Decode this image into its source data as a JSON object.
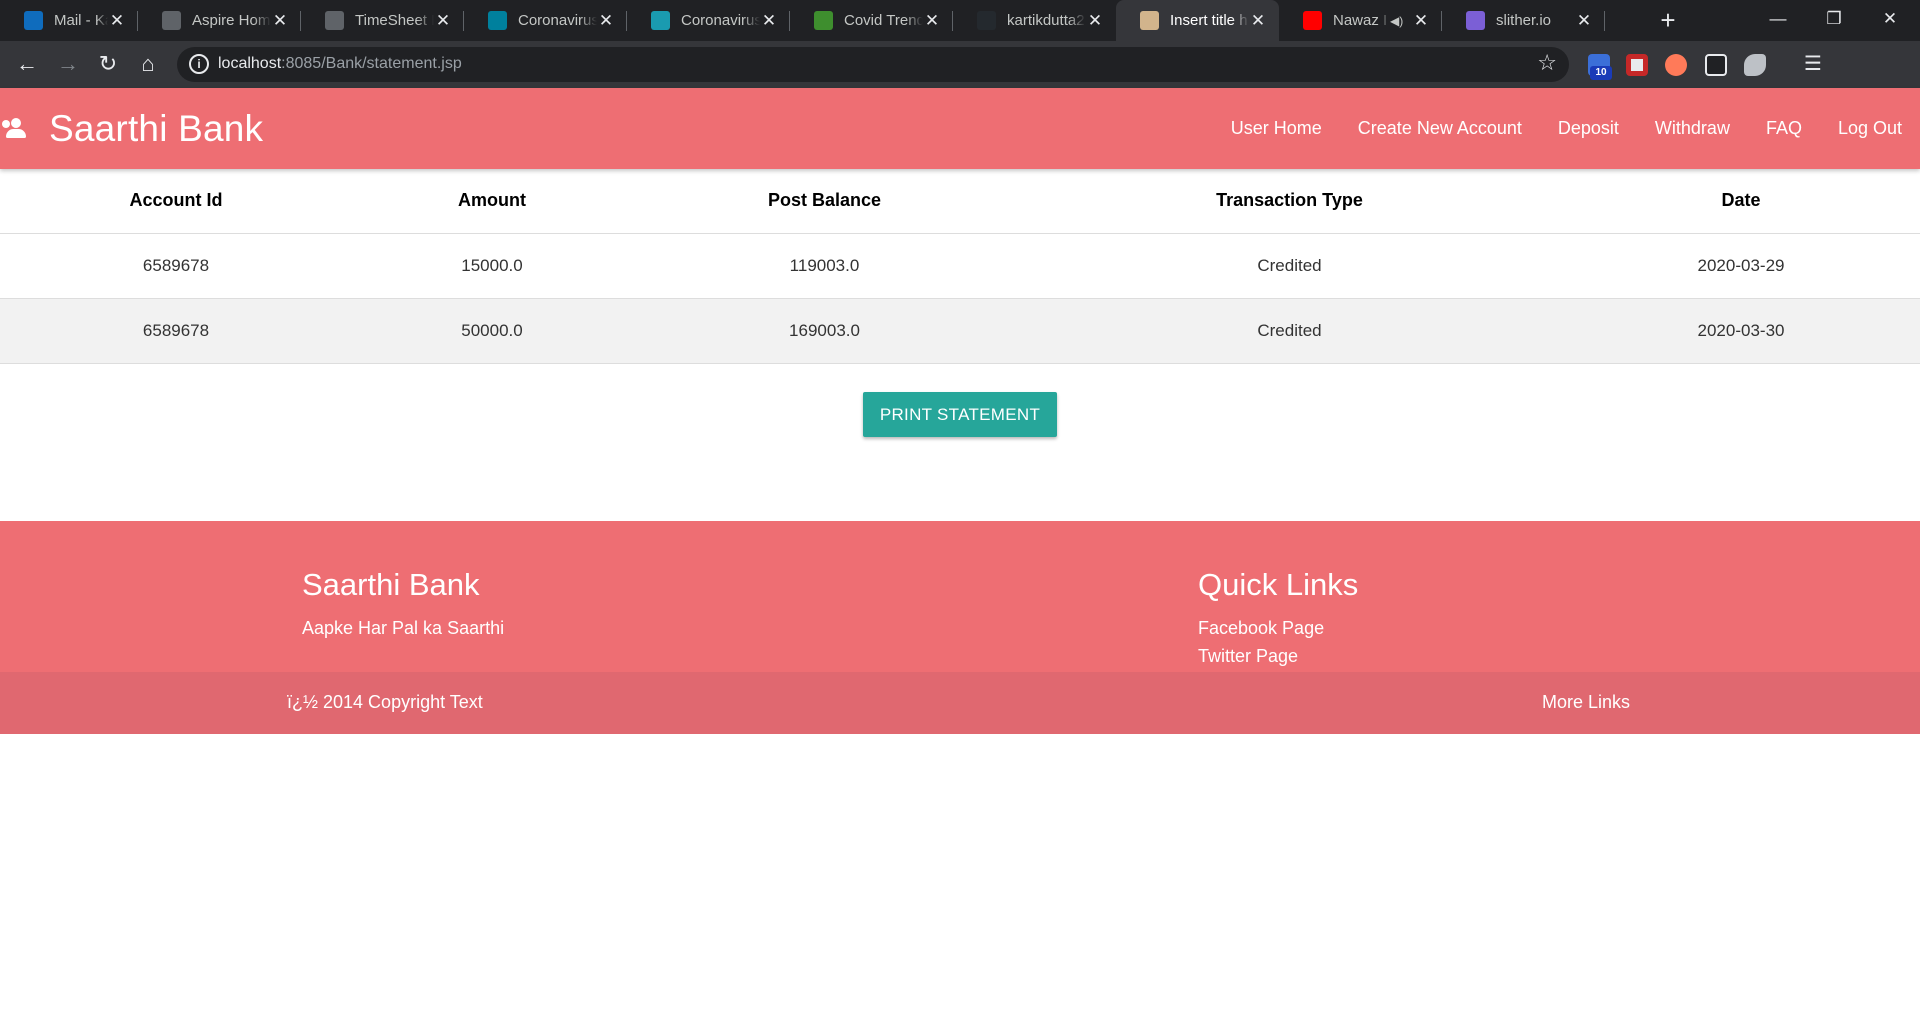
{
  "browser": {
    "tabs": [
      {
        "title": "Mail - Kartik",
        "icon": "outlook-icon",
        "color": "#0f6cbd",
        "active": false
      },
      {
        "title": "Aspire Home",
        "icon": "globe-icon",
        "color": "#5f6368",
        "active": false
      },
      {
        "title": "TimeSheet E",
        "icon": "globe-icon",
        "color": "#5f6368",
        "active": false
      },
      {
        "title": "Coronavirus",
        "icon": "bing-icon",
        "color": "#00809d",
        "active": false
      },
      {
        "title": "Coronavirus",
        "icon": "tracker-icon",
        "color": "#1a9bb0",
        "active": false
      },
      {
        "title": "Covid Trend",
        "icon": "virus-icon",
        "color": "#3e8e2e",
        "active": false
      },
      {
        "title": "kartikdutta2",
        "icon": "github-icon",
        "color": "#24292e",
        "active": false
      },
      {
        "title": "Insert title h",
        "icon": "page-icon",
        "color": "#d2b48c",
        "active": true
      },
      {
        "title": "Nawaz I",
        "icon": "youtube-icon",
        "color": "#ff0000",
        "active": false,
        "audio": true
      },
      {
        "title": "slither.io",
        "icon": "slither-icon",
        "color": "#7b5fd6",
        "active": false
      }
    ],
    "url_host": "localhost",
    "url_path": ":8085/Bank/statement.jsp",
    "extension_badge": "10"
  },
  "navbar": {
    "brand": "Saarthi Bank",
    "links": [
      "User Home",
      "Create New Account",
      "Deposit",
      "Withdraw",
      "FAQ",
      "Log Out"
    ]
  },
  "statement": {
    "headers": [
      "Account Id",
      "Amount",
      "Post Balance",
      "Transaction Type",
      "Date"
    ],
    "rows": [
      [
        "6589678",
        "15000.0",
        "119003.0",
        "Credited",
        "2020-03-29"
      ],
      [
        "6589678",
        "50000.0",
        "169003.0",
        "Credited",
        "2020-03-30"
      ]
    ],
    "print_button": "PRINT STATEMENT"
  },
  "footer": {
    "title": "Saarthi Bank",
    "tagline": "Aapke Har Pal ka Saarthi",
    "quick_links_title": "Quick Links",
    "quick_links": [
      "Facebook Page",
      "Twitter Page"
    ],
    "copyright": "ï¿½ 2014 Copyright Text",
    "more_links": "More Links"
  },
  "colors": {
    "brand": "#ee6e73",
    "footer_bottom": "#e06870",
    "button": "#26a69a"
  }
}
